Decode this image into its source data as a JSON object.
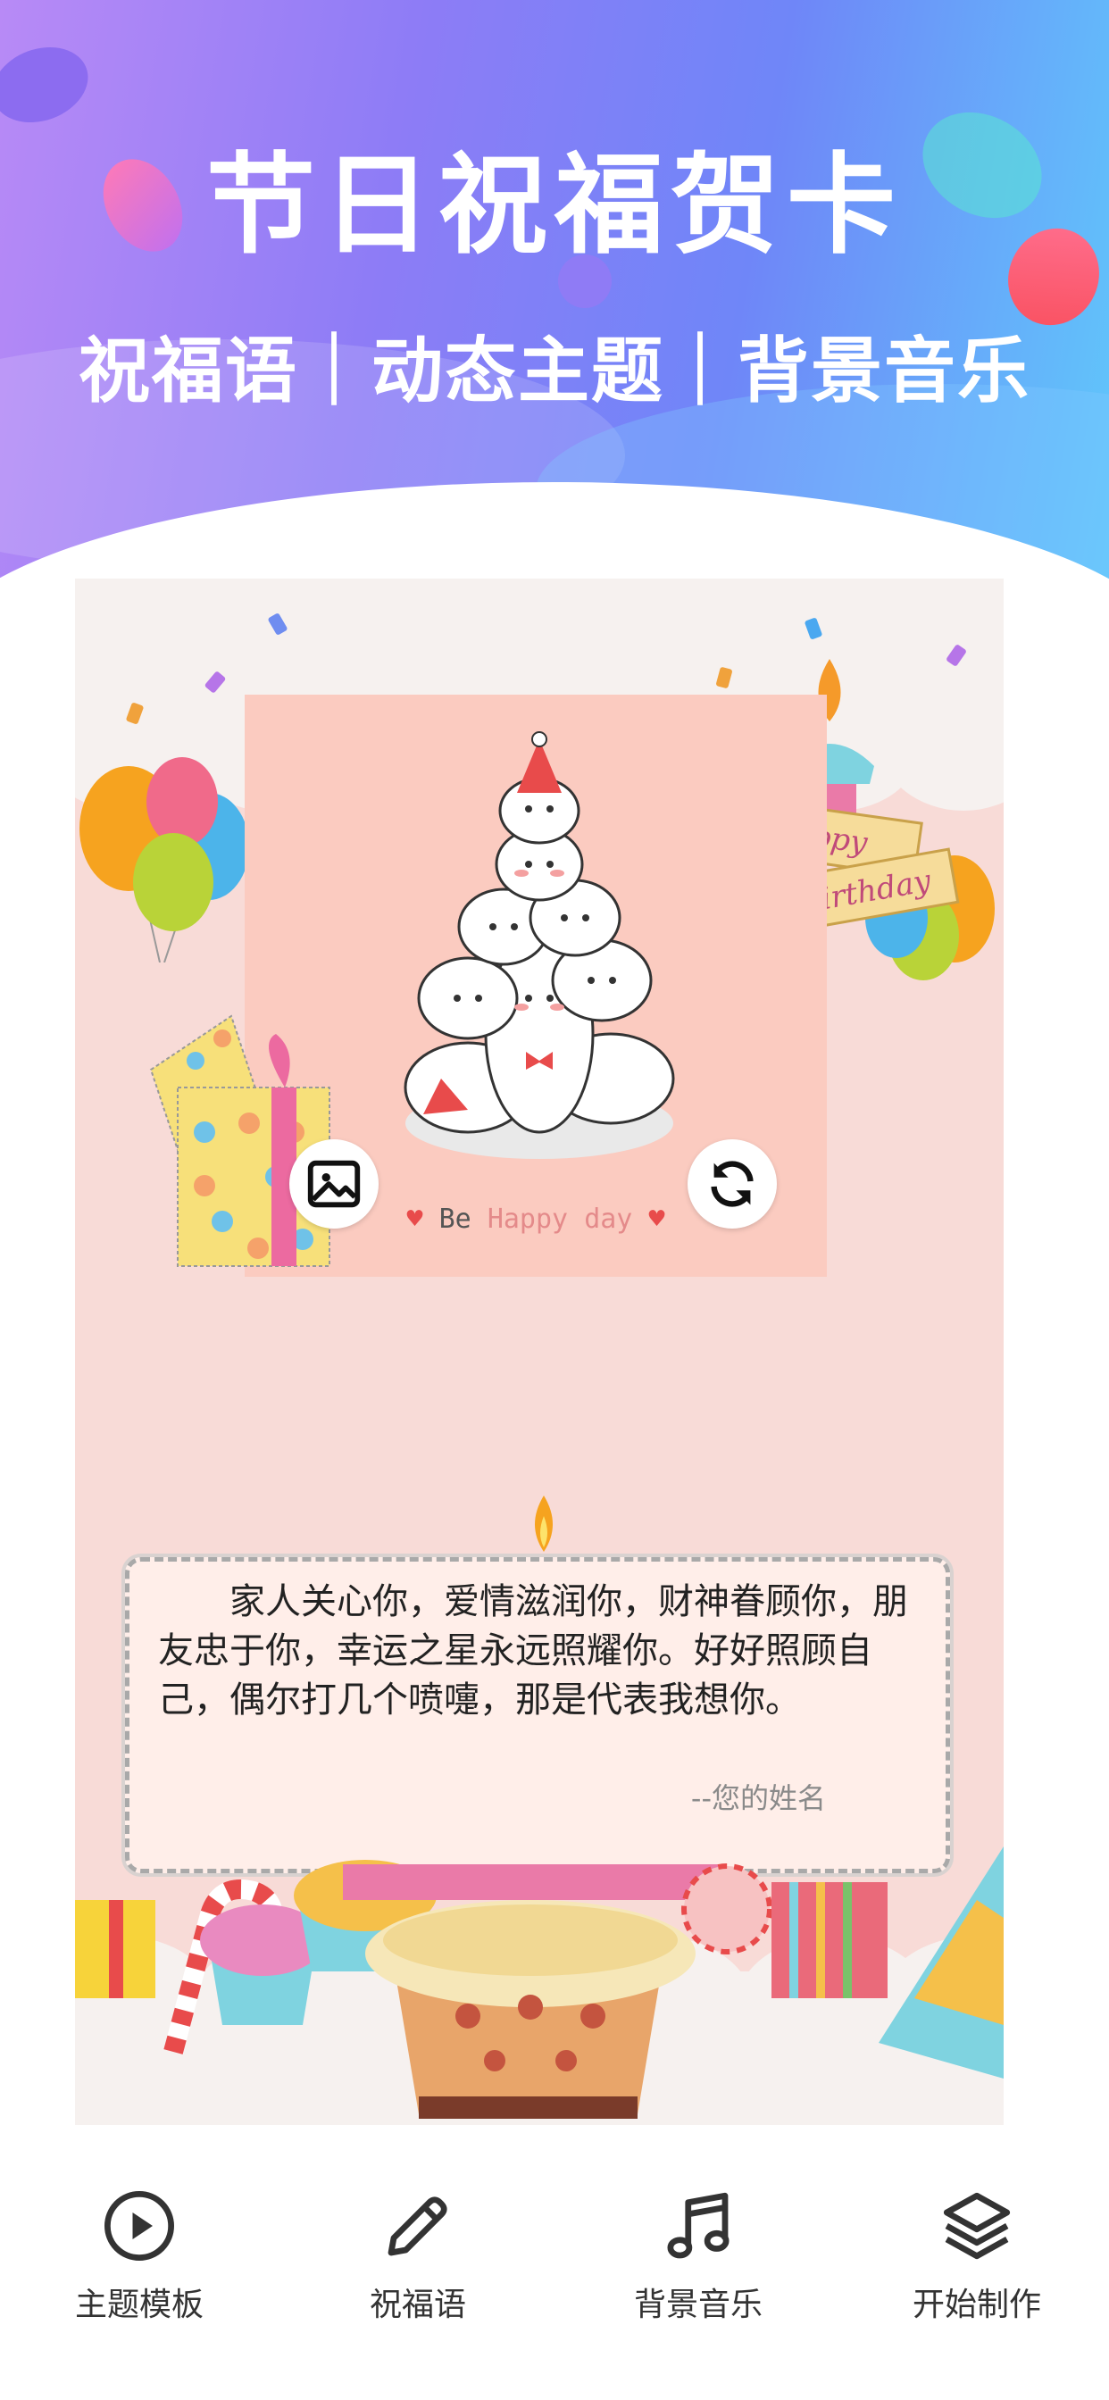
{
  "header": {
    "title": "节日祝福贺卡",
    "subtitle": "祝福语｜动态主题｜背景音乐"
  },
  "card": {
    "photo_caption_be": "Be",
    "photo_caption_happy": "Happy",
    "photo_caption_day": "day",
    "birthday_tag_line1": "Happy",
    "birthday_tag_line2": "Birthday",
    "change_image_icon": "image-icon",
    "refresh_icon": "refresh-icon",
    "message": "家人关心你，爱情滋润你，财神眷顾你，朋友忠于你，幸运之星永远照耀你。好好照顾自己，偶尔打几个喷嚏，那是代表我想你。",
    "signature": "--您的姓名"
  },
  "tabs": [
    {
      "label": "主题模板",
      "icon": "play-circle-icon"
    },
    {
      "label": "祝福语",
      "icon": "pencil-icon"
    },
    {
      "label": "背景音乐",
      "icon": "music-note-icon"
    },
    {
      "label": "开始制作",
      "icon": "layers-icon"
    }
  ],
  "colors": {
    "banner_start": "#b88af6",
    "banner_end": "#5fc9fb",
    "card_bg": "#f8dbd7",
    "photo_bg": "#fbcbc0",
    "message_bg": "#ffeee9"
  }
}
